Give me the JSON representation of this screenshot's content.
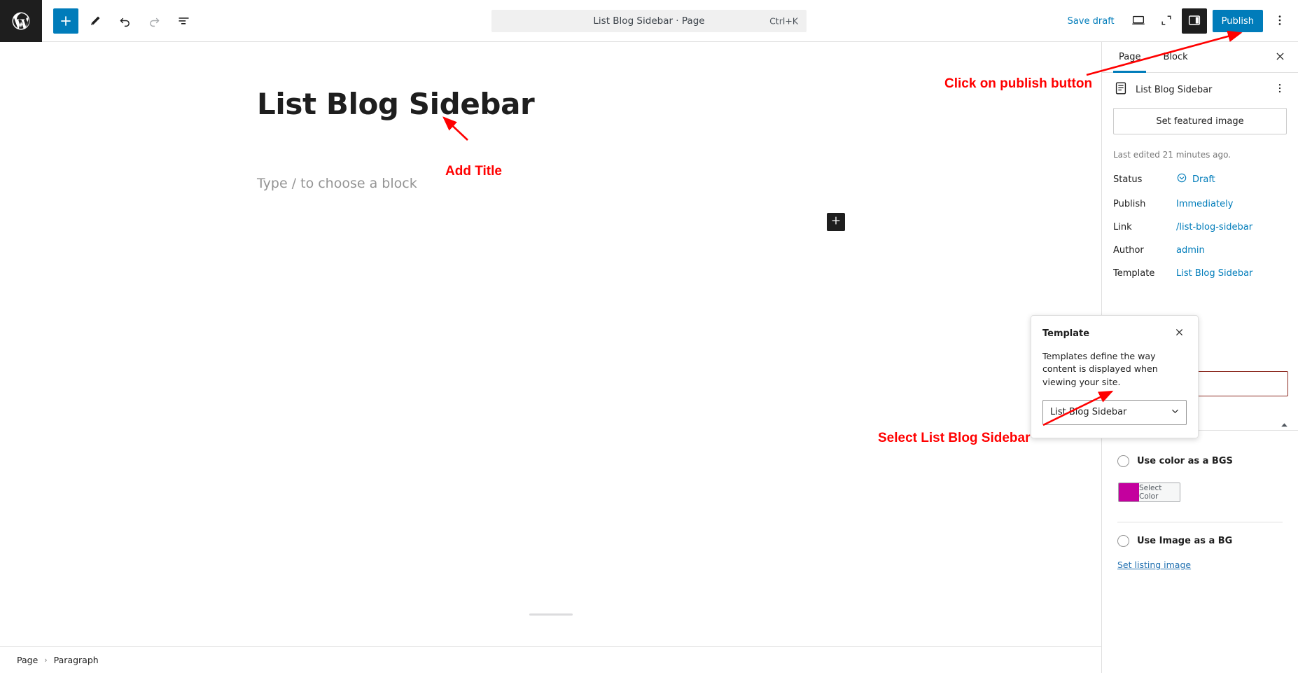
{
  "topbar": {
    "logo_icon": "wordpress-logo-icon",
    "tools": [
      {
        "name": "block-inserter-toggle",
        "icon": "plus-icon"
      },
      {
        "name": "tools-edit-mode",
        "icon": "pencil-icon"
      },
      {
        "name": "undo",
        "icon": "undo-arrow-icon"
      },
      {
        "name": "redo",
        "icon": "redo-arrow-icon"
      },
      {
        "name": "document-overview",
        "icon": "list-view-icon"
      }
    ],
    "command_bar": {
      "title": "List Blog Sidebar · Page",
      "shortcut": "Ctrl+K"
    },
    "save_draft_label": "Save draft",
    "preview_icon": "desktop-preview-icon",
    "fullscreen_icon": "expand-icon",
    "sidebar_toggle_icon": "settings-panel-icon",
    "publish_label": "Publish",
    "options_icon": "kebab-menu-icon",
    "accent_color": "#007cba"
  },
  "editor": {
    "post_title": "List Blog Sidebar",
    "paragraph_placeholder": "Type / to choose a block",
    "inserter_icon": "plus-icon"
  },
  "footer": {
    "breadcrumbs": [
      "Page",
      "Paragraph"
    ],
    "separator": "›"
  },
  "sidebar": {
    "tabs": [
      {
        "label": "Page",
        "selected": true
      },
      {
        "label": "Block",
        "selected": false
      }
    ],
    "close_icon": "close-icon",
    "document": {
      "icon": "page-document-icon",
      "name": "List Blog Sidebar",
      "menu_icon": "kebab-menu-icon"
    },
    "featured_image_label": "Set featured image",
    "last_edited": "Last edited 21 minutes ago.",
    "meta": [
      {
        "label": "Status",
        "value": "Draft",
        "icon": "draft-status-icon"
      },
      {
        "label": "Publish",
        "value": "Immediately",
        "icon": ""
      },
      {
        "label": "Link",
        "value": "/list-blog-sidebar",
        "icon": ""
      },
      {
        "label": "Author",
        "value": "admin",
        "icon": ""
      },
      {
        "label": "Template",
        "value": "List Blog Sidebar",
        "icon": ""
      }
    ],
    "template_popover": {
      "title": "Template",
      "close_icon": "close-icon",
      "description": "Templates define the way content is displayed when viewing your site.",
      "selected_option": "List Blog Sidebar",
      "chevron_icon": "chevron-down-icon",
      "options": [
        "List Blog Sidebar"
      ]
    },
    "custom_fields": {
      "collapse_icon": "caret-up-icon",
      "color_option_label": "Use color as a BGS",
      "color_swatch": "#c4009e",
      "select_color_label": "Select Color",
      "image_option_label": "Use Image as a BG",
      "set_listing_image_label": "Set listing image"
    }
  },
  "annotations": {
    "color": "#ff0000",
    "items": [
      {
        "id": "anno-publish",
        "text": "Click on publish button"
      },
      {
        "id": "anno-title",
        "text": "Add Title"
      },
      {
        "id": "anno-select",
        "text": "Select List Blog Sidebar"
      }
    ]
  }
}
